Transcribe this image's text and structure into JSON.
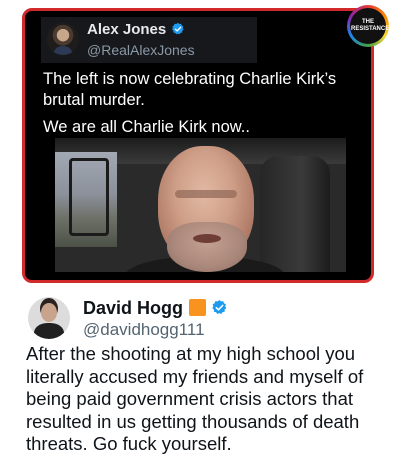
{
  "quoted_tweet": {
    "author_name": "Alex Jones",
    "author_handle": "@RealAlexJones",
    "verified_icon": "verified-badge-icon",
    "text_lines": [
      "The left is now celebrating Charlie Kirk’s",
      "brutal murder.",
      "We are all Charlie Kirk now.."
    ],
    "border_color": "#d22a2a",
    "background_color": "#000000"
  },
  "badge": {
    "text": "THE RESISTANCE"
  },
  "reply_tweet": {
    "author_name": "David Hogg",
    "author_handle": "@davidhogg111",
    "flag_color": "#f7931e",
    "verified_color": "#1d9bf0",
    "text_lines": [
      "After the shooting at my high school you",
      "literally accused my friends and myself of",
      "being paid government crisis actors that",
      "resulted in us getting thousands of death",
      "threats. Go fuck yourself."
    ]
  }
}
